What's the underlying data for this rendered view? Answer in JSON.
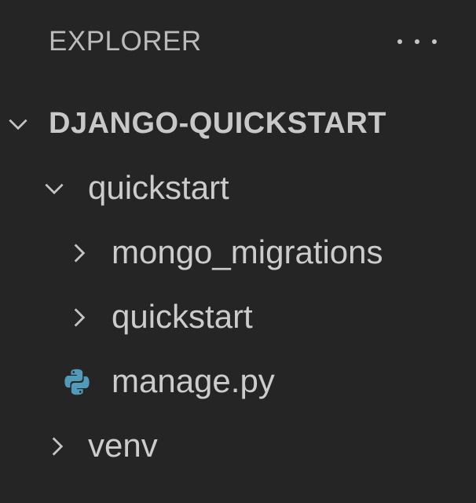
{
  "explorer": {
    "title": "EXPLORER",
    "more_actions_icon": "ellipsis-icon"
  },
  "tree": {
    "root": {
      "label": "DJANGO-QUICKSTART",
      "expanded": true,
      "icon": "chevron-down-icon"
    },
    "items": [
      {
        "label": "quickstart",
        "type": "folder",
        "expanded": true,
        "icon": "chevron-down-icon"
      },
      {
        "label": "mongo_migrations",
        "type": "folder",
        "expanded": false,
        "icon": "chevron-right-icon"
      },
      {
        "label": "quickstart",
        "type": "folder",
        "expanded": false,
        "icon": "chevron-right-icon"
      },
      {
        "label": "manage.py",
        "type": "file",
        "icon": "python-file-icon"
      },
      {
        "label": "venv",
        "type": "folder",
        "expanded": false,
        "icon": "chevron-right-icon"
      }
    ]
  },
  "colors": {
    "background": "#252526",
    "text": "#cccccc",
    "python_icon": "#519aba"
  }
}
